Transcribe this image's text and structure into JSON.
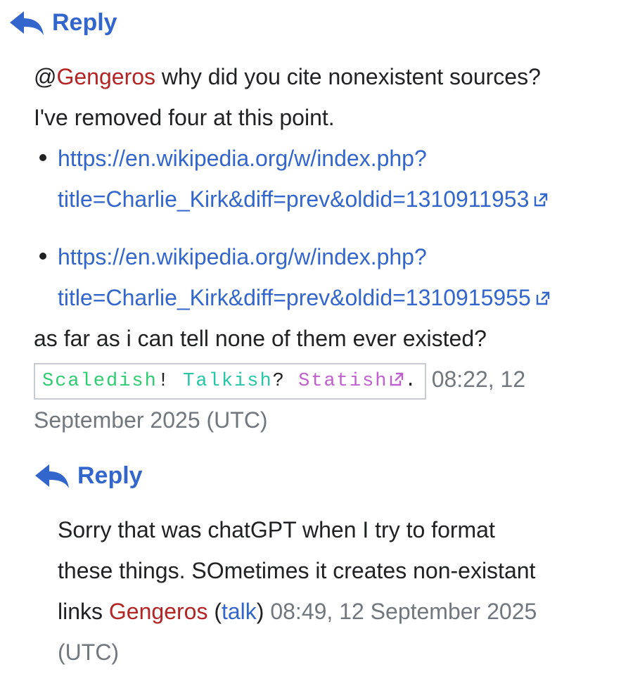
{
  "reply_label": "Reply",
  "comment1": {
    "mention_prefix": "@",
    "mention_user": "Gengeros",
    "line1_text": " why did you cite nonexistent sources?",
    "line2_text": "I've removed four at this point.",
    "links": [
      {
        "line1": "https://en.wikipedia.org/w/index.php?",
        "line2": "title=Charlie_Kirk&diff=prev&oldid=1310911953"
      },
      {
        "line1": "https://en.wikipedia.org/w/index.php?",
        "line2": "title=Charlie_Kirk&diff=prev&oldid=1310915955"
      }
    ],
    "closing_text": "as far as i can tell none of them ever existed?",
    "signature": {
      "part1": "Scaledish",
      "punct1": "!",
      "part2": "Talkish",
      "punct2": "?",
      "part3": "Statish",
      "punct3": "."
    },
    "timestamp_line1": "08:22, 12",
    "timestamp_line2": "September 2025 (UTC)"
  },
  "comment2": {
    "line1": "Sorry that was chatGPT when I try to format",
    "line2": "these things. SOmetimes it creates non-existant",
    "line3_prefix": "links ",
    "user": "Gengeros",
    "paren_open": "(",
    "talk": "talk",
    "paren_close": ")",
    "timestamp_line3": " 08:49, 12 September 2025",
    "timestamp_line4": "(UTC)"
  },
  "icons": {
    "reply": "reply-arrow-icon",
    "external": "external-link-icon"
  },
  "colors": {
    "link": "#3366cc",
    "user": "#b32424",
    "timestamp": "#72777d",
    "sig_green": "#2ecc71",
    "sig_teal": "#26c6a6",
    "sig_purple": "#c060d0"
  }
}
